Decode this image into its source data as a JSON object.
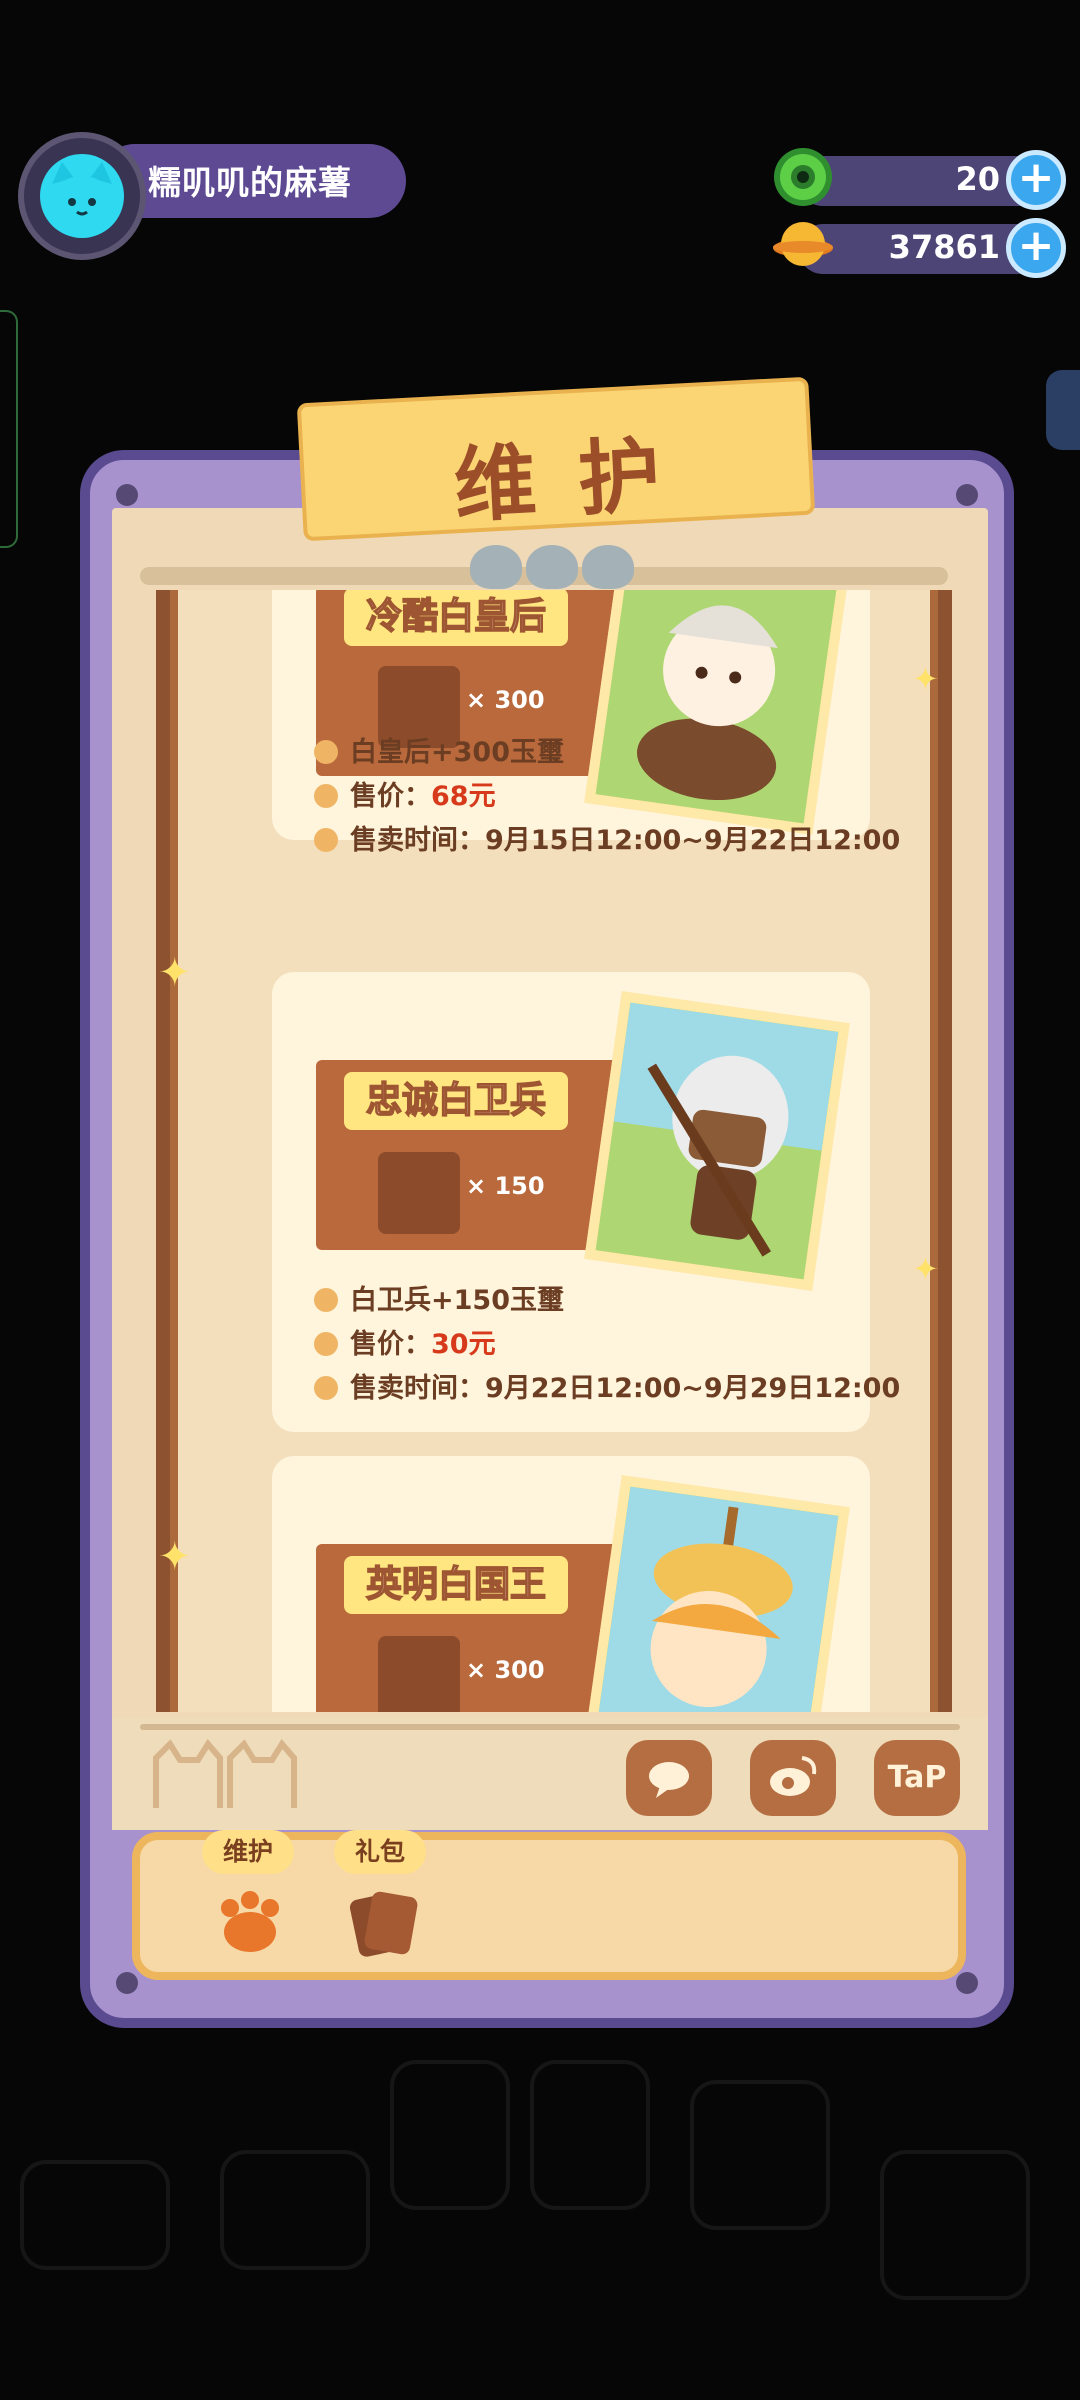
{
  "user": {
    "name": "糯叽叽的麻薯"
  },
  "currencies": [
    {
      "name": "jade-coin",
      "value": "20",
      "color": "#49c34b"
    },
    {
      "name": "gold-planet",
      "value": "37861",
      "color": "#f5b331"
    }
  ],
  "dialog": {
    "title": "维护",
    "offers": [
      {
        "name": "冷酷白皇后",
        "count": "× 300",
        "bonus": "白皇后+300玉璽",
        "price_label": "售价：",
        "price": "68元",
        "time_label": "售卖时间：",
        "time": "9月15日12:00~9月22日12:00"
      },
      {
        "name": "忠诚白卫兵",
        "count": "× 150",
        "bonus": "白卫兵+150玉璽",
        "price_label": "售价：",
        "price": "30元",
        "time_label": "售卖时间：",
        "time": "9月22日12:00~9月29日12:00"
      },
      {
        "name": "英明白国王",
        "count": "× 300"
      }
    ],
    "footer_buttons": [
      {
        "name": "chat-icon"
      },
      {
        "name": "weibo-icon"
      },
      {
        "name": "taptap-icon",
        "label": "TaP"
      }
    ]
  },
  "tabs": [
    {
      "label": "维护",
      "icon": "paw-icon"
    },
    {
      "label": "礼包",
      "icon": "card-icon"
    }
  ],
  "colors": {
    "accent_price": "#d73a1a",
    "frame": "#a792ce",
    "board": "#f0d9b6"
  }
}
